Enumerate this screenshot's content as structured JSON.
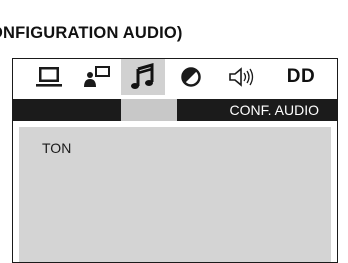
{
  "page": {
    "heading": "ONFIGURATION AUDIO)"
  },
  "osd": {
    "tabs": [
      {
        "id": "general",
        "icon": "monitor-icon",
        "active": false
      },
      {
        "id": "video",
        "icon": "person-screen-icon",
        "active": false
      },
      {
        "id": "audio",
        "icon": "music-note-icon",
        "active": true
      },
      {
        "id": "preference",
        "icon": "circle-slash-icon",
        "active": false
      },
      {
        "id": "speaker",
        "icon": "speaker-icon",
        "active": false
      },
      {
        "id": "dolby",
        "label": "DD",
        "active": false
      }
    ],
    "title": "CONF. AUDIO",
    "options": [
      "TON"
    ]
  },
  "colors": {
    "title_bar": "#1b1b1b",
    "active_tab": "#d1d1d1",
    "content_bg": "#d4d4d4"
  }
}
